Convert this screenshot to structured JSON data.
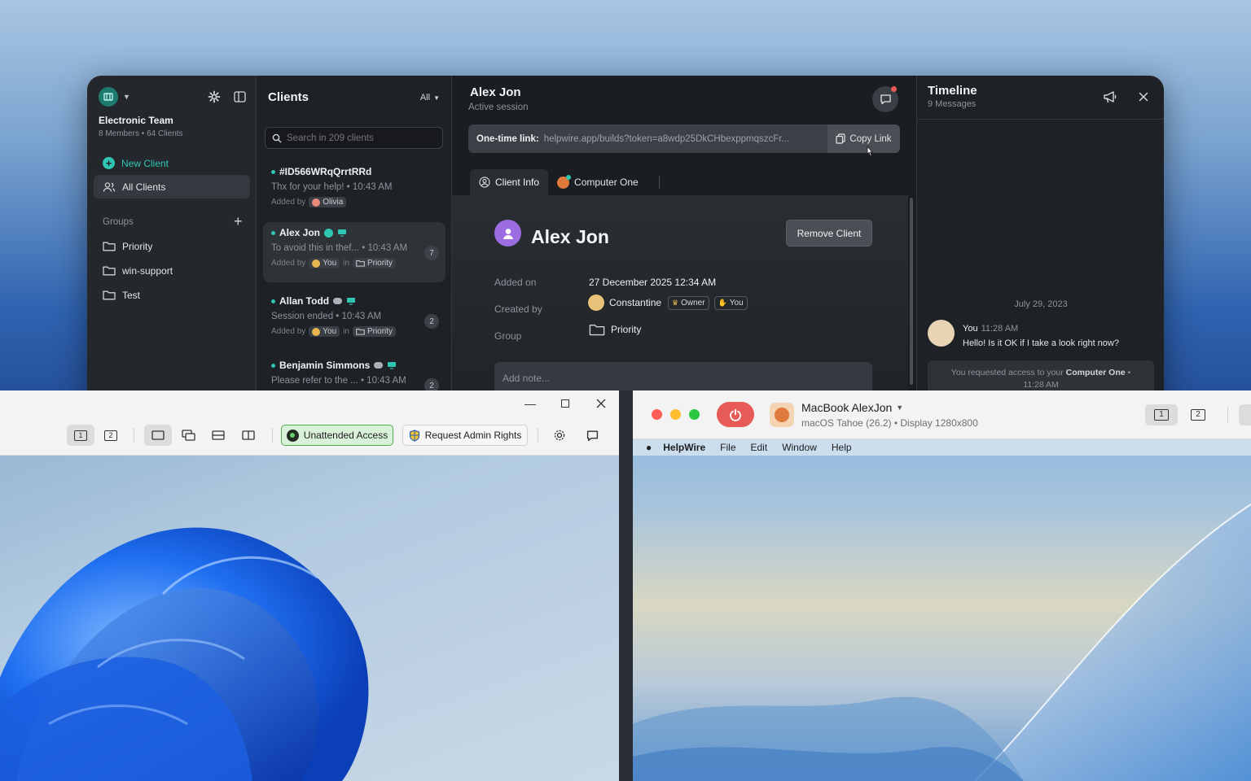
{
  "sidebar": {
    "team_name": "Electronic Team",
    "team_meta": "8 Members • 64 Clients",
    "new_client": "New Client",
    "all_clients": "All Clients",
    "groups_label": "Groups",
    "groups": [
      "Priority",
      "win-support",
      "Test"
    ]
  },
  "clients": {
    "title": "Clients",
    "filter": "All",
    "search_placeholder": "Search in 209 clients",
    "added_by": "Added by",
    "in": "in",
    "items": [
      {
        "name": "#ID566WRqQrrtRRd",
        "message": "Thx for your help! • 10:43 AM",
        "by": "Olivia",
        "group": "",
        "count": ""
      },
      {
        "name": "Alex Jon",
        "message": "To avoid this in thef... • 10:43 AM",
        "by": "You",
        "group": "Priority",
        "count": "7"
      },
      {
        "name": "Allan Todd",
        "message": "Session ended • 10:43 AM",
        "by": "You",
        "group": "Priority",
        "count": "2"
      },
      {
        "name": "Benjamin Simmons",
        "message": "Please refer to the ... • 10:43 AM",
        "by": "",
        "group": "",
        "count": "2"
      }
    ]
  },
  "main": {
    "title": "Alex Jon",
    "subtitle": "Active session",
    "link_label": "One-time link:",
    "link_url": "helpwire.app/builds?token=a8wdp25DkCHbexppmqszcFr...",
    "copy_link": "Copy Link",
    "tabs": [
      "Client Info",
      "Computer One"
    ],
    "client_name": "Alex Jon",
    "remove_client": "Remove Client",
    "added_on_label": "Added on",
    "added_on_value": "27 December 2025 12:34 AM",
    "created_by_label": "Created by",
    "created_by_value": "Constantine",
    "owner_badge": "Owner",
    "you_badge": "You",
    "group_label": "Group",
    "group_value": "Priority",
    "note_placeholder": "Add note..."
  },
  "timeline": {
    "title": "Timeline",
    "count": "9 Messages",
    "date": "July 29, 2023",
    "msg_author": "You",
    "msg_time": "11:28 AM",
    "msg_text": "Hello! Is it OK if I take a look right now?",
    "system_prefix": "You requested access to your",
    "system_target": "Computer One",
    "system_suffix": "•",
    "system_time": "11:28 AM"
  },
  "win_viewer": {
    "monitor_1": "1",
    "monitor_2": "2",
    "unattended": "Unattended Access",
    "admin_rights": "Request Admin Rights"
  },
  "mac_viewer": {
    "device_name": "MacBook AlexJon",
    "device_meta": "macOS Tahoe (26.2) • Display 1280x800",
    "monitor_1": "1",
    "monitor_2": "2",
    "menu": [
      "HelpWire",
      "File",
      "Edit",
      "Window",
      "Help"
    ]
  },
  "colors": {
    "accent": "#2fc6b3",
    "danger": "#e85a55",
    "unattended_bg": "#d9f1d8"
  }
}
